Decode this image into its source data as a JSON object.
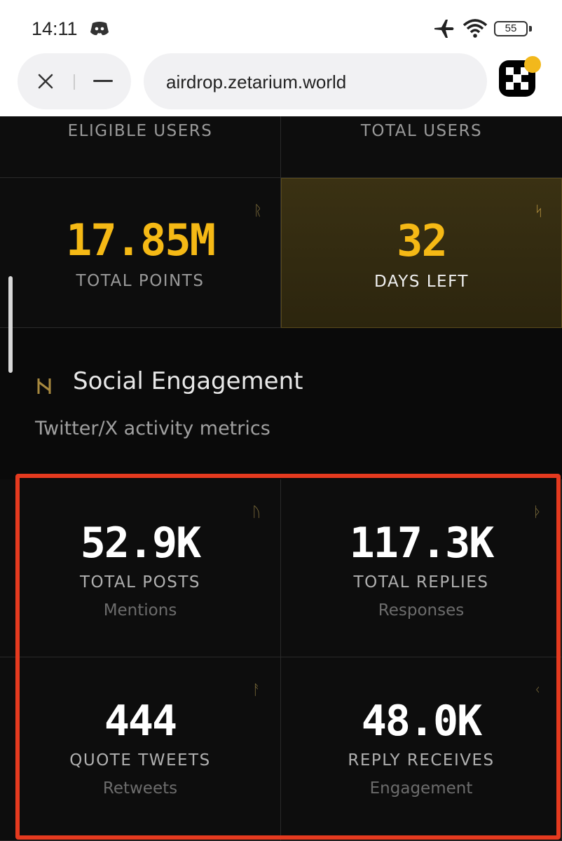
{
  "status_bar": {
    "time": "14:11",
    "battery": "55",
    "icons": [
      "discord-icon",
      "airplane-icon",
      "wifi-icon",
      "battery-icon"
    ]
  },
  "browser": {
    "url": "airdrop.zetarium.world",
    "icons": [
      "close-icon",
      "minimize-icon",
      "extension-icon"
    ]
  },
  "stats_top": {
    "eligible_users_label": "ELIGIBLE USERS",
    "total_users_label": "TOTAL USERS"
  },
  "stats_mid": {
    "total_points_value": "17.85M",
    "total_points_label": "TOTAL POINTS",
    "total_points_rune": "ᚱ",
    "days_left_value": "32",
    "days_left_label": "DAYS LEFT",
    "days_left_rune": "ᛋ"
  },
  "social": {
    "title": "Social Engagement",
    "subtitle": "Twitter/X activity metrics",
    "cards": [
      {
        "value": "52.9K",
        "label": "TOTAL POSTS",
        "sub": "Mentions",
        "rune": "ᚢ"
      },
      {
        "value": "117.3K",
        "label": "TOTAL REPLIES",
        "sub": "Responses",
        "rune": "ᚦ"
      },
      {
        "value": "444",
        "label": "QUOTE TWEETS",
        "sub": "Retweets",
        "rune": "ᚨ"
      },
      {
        "value": "48.0K",
        "label": "REPLY RECEIVES",
        "sub": "Engagement",
        "rune": "ᚲ"
      }
    ]
  },
  "colors": {
    "accent": "#f5b915",
    "highlight_bg": "#2f2810",
    "annotation_red": "#e53a1f"
  }
}
